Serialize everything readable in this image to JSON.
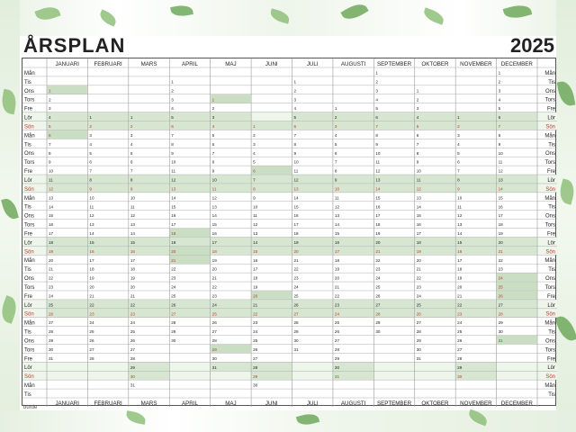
{
  "title": "ÅRSPLAN",
  "year": "2025",
  "brand": "burde",
  "months": [
    "JANUARI",
    "FEBRUARI",
    "MARS",
    "APRIL",
    "MAJ",
    "JUNI",
    "JULI",
    "AUGUSTI",
    "SEPTEMBER",
    "OKTOBER",
    "NOVEMBER",
    "DECEMBER"
  ],
  "weekday_names": [
    "Mån",
    "Tis",
    "Ons",
    "Tors",
    "Fre",
    "Lör",
    "Sön"
  ],
  "month_start_weekday": [
    2,
    5,
    5,
    1,
    3,
    6,
    1,
    4,
    0,
    2,
    5,
    0
  ],
  "month_days": [
    31,
    28,
    31,
    30,
    31,
    30,
    31,
    31,
    30,
    31,
    30,
    31
  ],
  "holiday_dates": [
    [
      1,
      1
    ],
    [
      1,
      6
    ],
    [
      4,
      18
    ],
    [
      4,
      20
    ],
    [
      4,
      21
    ],
    [
      5,
      1
    ],
    [
      5,
      29
    ],
    [
      6,
      6
    ],
    [
      6,
      20
    ],
    [
      12,
      24
    ],
    [
      12,
      25
    ],
    [
      12,
      26
    ],
    [
      12,
      31
    ]
  ],
  "colors": {
    "weekend_fill": "#d6e6d0",
    "holiday_fill": "#d6e6d0",
    "sunday_text": "#c0392b",
    "grid": "#9a9a9a",
    "text": "#222222"
  }
}
